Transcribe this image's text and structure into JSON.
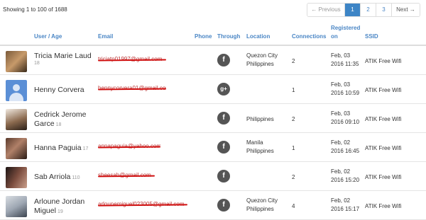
{
  "showing_text": "Showing 1 to 100 of 1688",
  "pagination": {
    "previous_label": "← Previous",
    "pages": [
      "1",
      "2",
      "3"
    ],
    "active_page": "1",
    "next_label": "Next →"
  },
  "columns": {
    "user_age": "User / Age",
    "email": "Email",
    "phone": "Phone",
    "through": "Through",
    "location": "Location",
    "connections": "Connections",
    "registered_line1": "Registered",
    "registered_line2": "on",
    "ssid": "SSID"
  },
  "rows": [
    {
      "name": "Tricia Marie Laud",
      "age": "18",
      "email": "triciatp01997@gmail.com",
      "through": "f",
      "location_line1": "Quezon City",
      "location_line2": "Philippines",
      "connections": "2",
      "registered_line1": "Feb, 03",
      "registered_line2": "2016 11:35",
      "ssid": "ATIK Free Wifi"
    },
    {
      "name": "Henny Corvera",
      "age": "",
      "email": "hennycorvera01@gmail.com",
      "through": "g+",
      "location_line1": "",
      "location_line2": "",
      "connections": "1",
      "registered_line1": "Feb, 03",
      "registered_line2": "2016 10:59",
      "ssid": "ATIK Free Wifi"
    },
    {
      "name": "Cedrick Jerome Garce",
      "age": "18",
      "email": "",
      "through": "f",
      "location_line1": "Philippines",
      "location_line2": "",
      "connections": "2",
      "registered_line1": "Feb, 03",
      "registered_line2": "2016 09:10",
      "ssid": "ATIK Free Wifi"
    },
    {
      "name": "Hanna Paguia",
      "age": "17",
      "email": "annapaguia@yahoo.com",
      "through": "f",
      "location_line1": "Manila",
      "location_line2": "Philippines",
      "connections": "1",
      "registered_line1": "Feb, 02",
      "registered_line2": "2016 16:45",
      "ssid": "ATIK Free Wifi"
    },
    {
      "name": "Sab Arriola",
      "age": "110",
      "email": "sheesab@gmail.com",
      "through": "f",
      "location_line1": "",
      "location_line2": "",
      "connections": "2",
      "registered_line1": "Feb, 02",
      "registered_line2": "2016 15:20",
      "ssid": "ATIK Free Wifi"
    },
    {
      "name": "Arloune Jordan Miguel",
      "age": "19",
      "email": "arlounemiguel023005@gmail.com",
      "through": "f",
      "location_line1": "Quezon City",
      "location_line2": "Philippines",
      "connections": "4",
      "registered_line1": "Feb, 02",
      "registered_line2": "2016 15:17",
      "ssid": "ATIK Free Wifi"
    }
  ]
}
